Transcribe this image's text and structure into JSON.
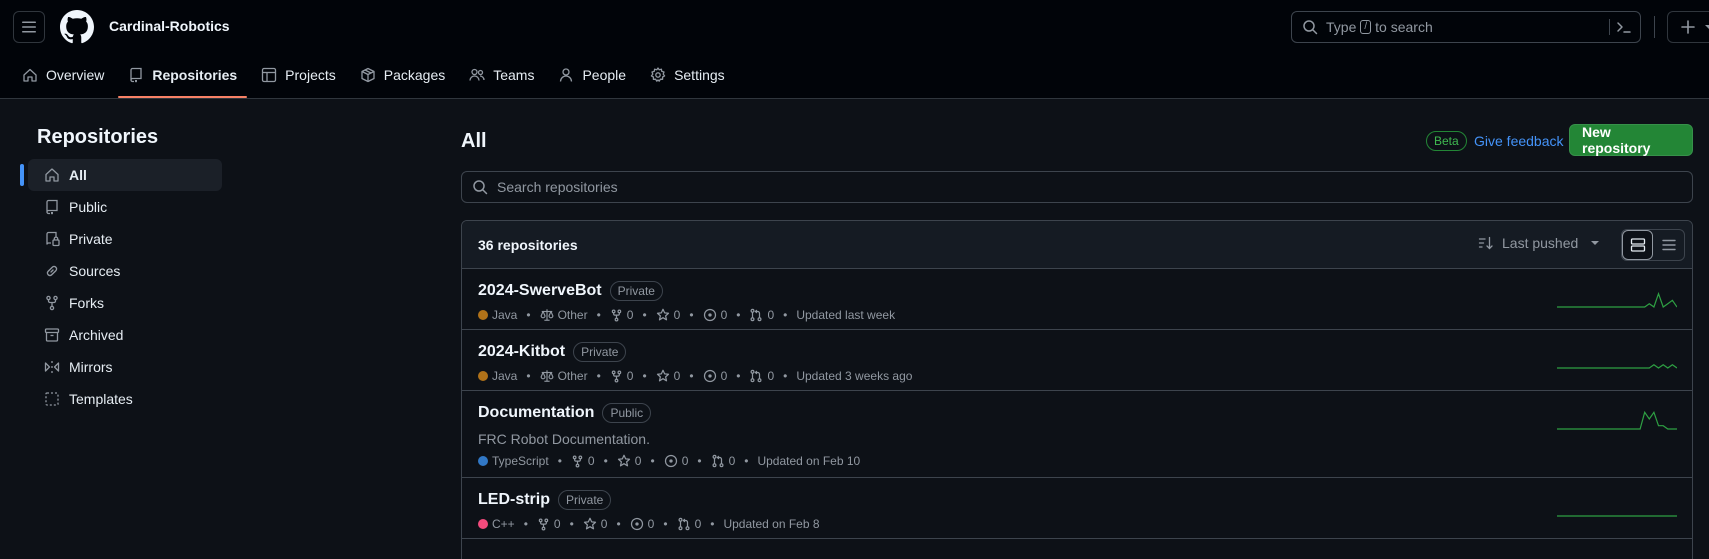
{
  "header": {
    "org_name": "Cardinal-Robotics",
    "search_before": "Type",
    "search_key": "/",
    "search_after": "to search"
  },
  "nav": [
    {
      "label": "Overview",
      "icon": "book-open-icon",
      "active": false
    },
    {
      "label": "Repositories",
      "icon": "repo-icon",
      "active": true
    },
    {
      "label": "Projects",
      "icon": "table-icon",
      "active": false
    },
    {
      "label": "Packages",
      "icon": "package-icon",
      "active": false
    },
    {
      "label": "Teams",
      "icon": "people-icon",
      "active": false
    },
    {
      "label": "People",
      "icon": "person-icon",
      "active": false
    },
    {
      "label": "Settings",
      "icon": "gear-icon",
      "active": false
    }
  ],
  "sidebar": {
    "title": "Repositories",
    "items": [
      {
        "label": "All",
        "icon": "home-icon",
        "active": true
      },
      {
        "label": "Public",
        "icon": "repo-icon"
      },
      {
        "label": "Private",
        "icon": "repo-locked-icon"
      },
      {
        "label": "Sources",
        "icon": "link-icon"
      },
      {
        "label": "Forks",
        "icon": "fork-icon"
      },
      {
        "label": "Archived",
        "icon": "archive-icon"
      },
      {
        "label": "Mirrors",
        "icon": "mirror-icon"
      },
      {
        "label": "Templates",
        "icon": "template-icon"
      }
    ]
  },
  "main": {
    "title": "All",
    "beta": "Beta",
    "feedback": "Give feedback",
    "new_repo": "New repository",
    "search_placeholder": "Search repositories",
    "count": "36 repositories",
    "sort": "Last pushed"
  },
  "repos": [
    {
      "name": "2024-SwerveBot",
      "visibility": "Private",
      "description": "",
      "language": "Java",
      "lang_color": "#b07219",
      "license": "Other",
      "forks": "0",
      "stars": "0",
      "issues": "0",
      "prs": "0",
      "updated": "Updated last week",
      "activity": [
        0,
        0,
        0,
        0,
        0,
        0,
        0,
        0,
        0,
        0,
        0,
        0,
        0,
        0,
        0,
        0,
        0,
        0,
        0,
        0,
        1,
        0,
        4,
        0,
        1,
        2,
        0
      ]
    },
    {
      "name": "2024-Kitbot",
      "visibility": "Private",
      "description": "",
      "language": "Java",
      "lang_color": "#b07219",
      "license": "Other",
      "forks": "0",
      "stars": "0",
      "issues": "0",
      "prs": "0",
      "updated": "Updated 3 weeks ago",
      "activity": [
        0,
        0,
        0,
        0,
        0,
        0,
        0,
        0,
        0,
        0,
        0,
        0,
        0,
        0,
        0,
        0,
        0,
        0,
        0,
        0,
        0,
        1,
        0,
        1,
        0,
        1,
        0
      ]
    },
    {
      "name": "Documentation",
      "visibility": "Public",
      "description": "FRC Robot Documentation.",
      "language": "TypeScript",
      "lang_color": "#3178c6",
      "license": "",
      "forks": "0",
      "stars": "0",
      "issues": "0",
      "prs": "0",
      "updated": "Updated on Feb 10",
      "activity": [
        0,
        0,
        0,
        0,
        0,
        0,
        0,
        0,
        0,
        0,
        0,
        0,
        0,
        0,
        0,
        0,
        0,
        0,
        0,
        5,
        3,
        5,
        1,
        1,
        0,
        0,
        0
      ]
    },
    {
      "name": "LED-strip",
      "visibility": "Private",
      "description": "",
      "language": "C++",
      "lang_color": "#f34b7d",
      "license": "",
      "forks": "0",
      "stars": "0",
      "issues": "0",
      "prs": "0",
      "updated": "Updated on Feb 8",
      "activity": [
        0,
        0,
        0,
        0,
        0,
        0,
        0,
        0,
        0,
        0,
        0,
        0,
        0,
        0,
        0,
        0,
        0,
        0,
        0,
        0,
        0,
        0,
        0,
        0,
        0,
        0,
        0
      ]
    }
  ],
  "colors": {
    "accent": "#238636",
    "link": "#4493f8",
    "spark": "#2ea043",
    "nav_underline": "#f78166"
  }
}
